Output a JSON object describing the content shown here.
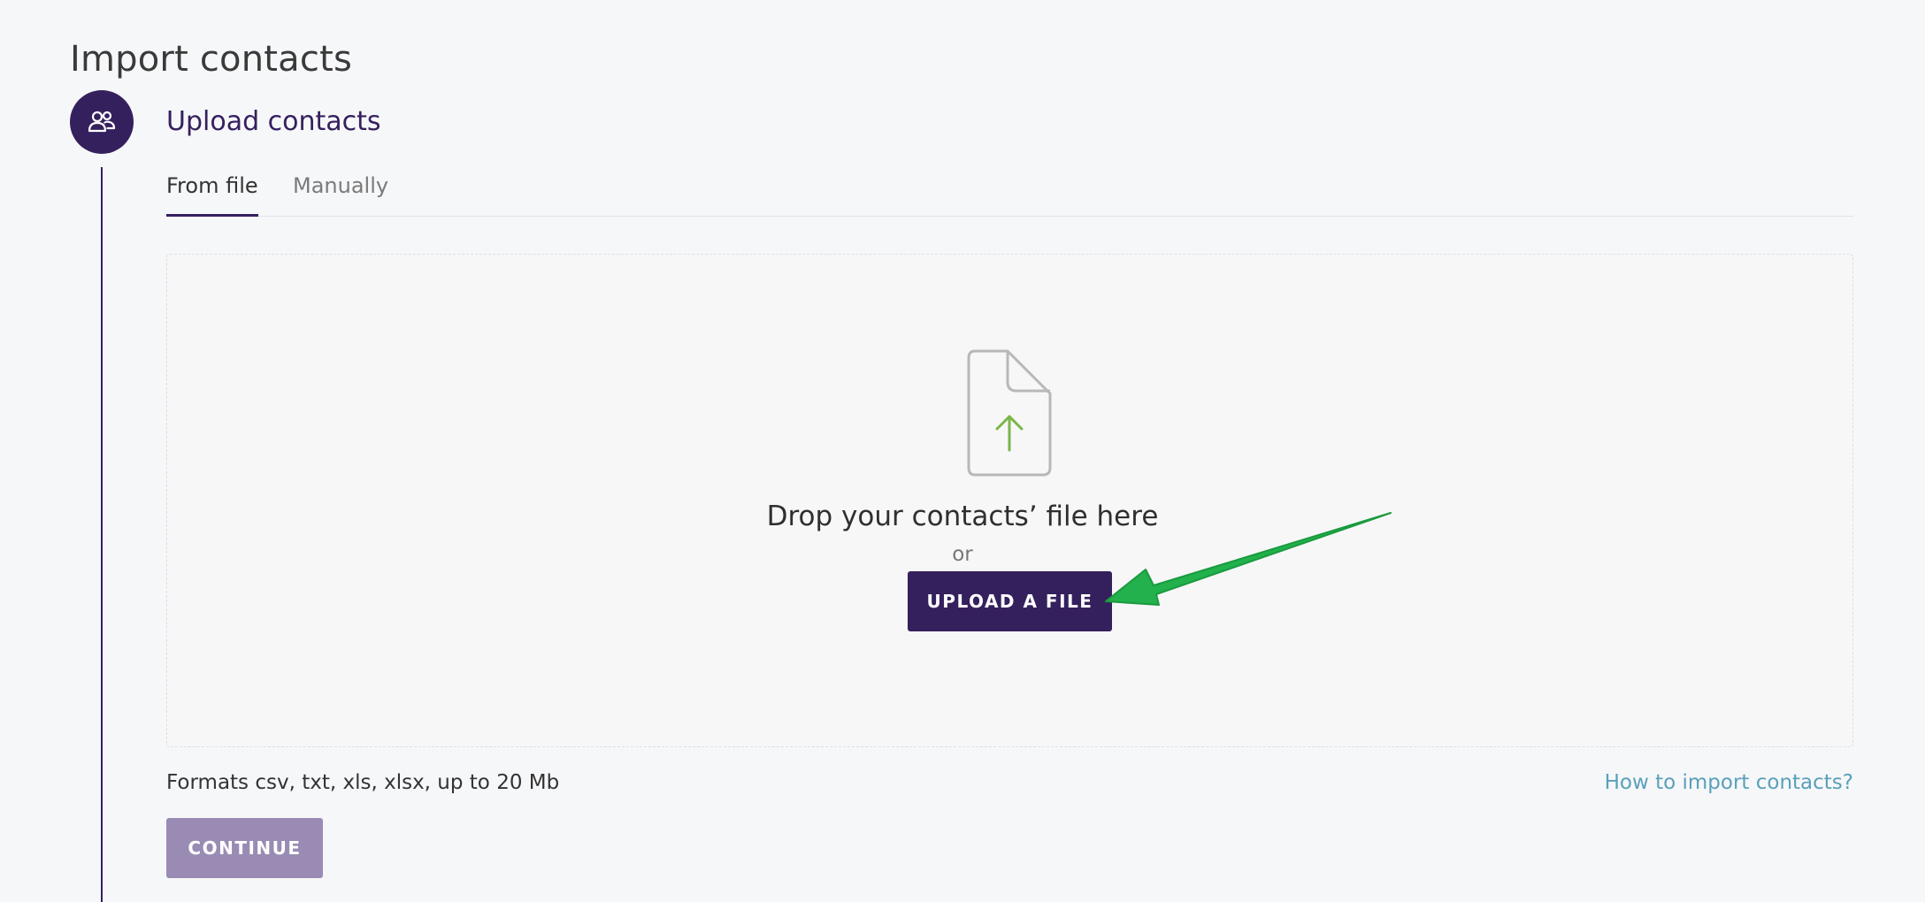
{
  "page": {
    "title": "Import contacts"
  },
  "step": {
    "icon": "contacts-people-icon",
    "title": "Upload contacts"
  },
  "tabs": [
    {
      "label": "From file",
      "active": true
    },
    {
      "label": "Manually",
      "active": false
    }
  ],
  "dropzone": {
    "icon": "file-upload-icon",
    "drop_text": "Drop your contacts’ file here",
    "or_text": "or",
    "upload_button": "UPLOAD A FILE"
  },
  "footer": {
    "formats": "Formats csv, txt, xls, xlsx, up to 20 Mb",
    "help_link": "How to import contacts?",
    "continue_button": "CONTINUE"
  },
  "annotation": {
    "icon": "green-arrow-icon",
    "color": "#22b14c"
  },
  "colors": {
    "brand": "#35205e",
    "brand_disabled": "#9a8bb4",
    "link": "#5aa0b9",
    "upload_arrow": "#7ab648"
  }
}
